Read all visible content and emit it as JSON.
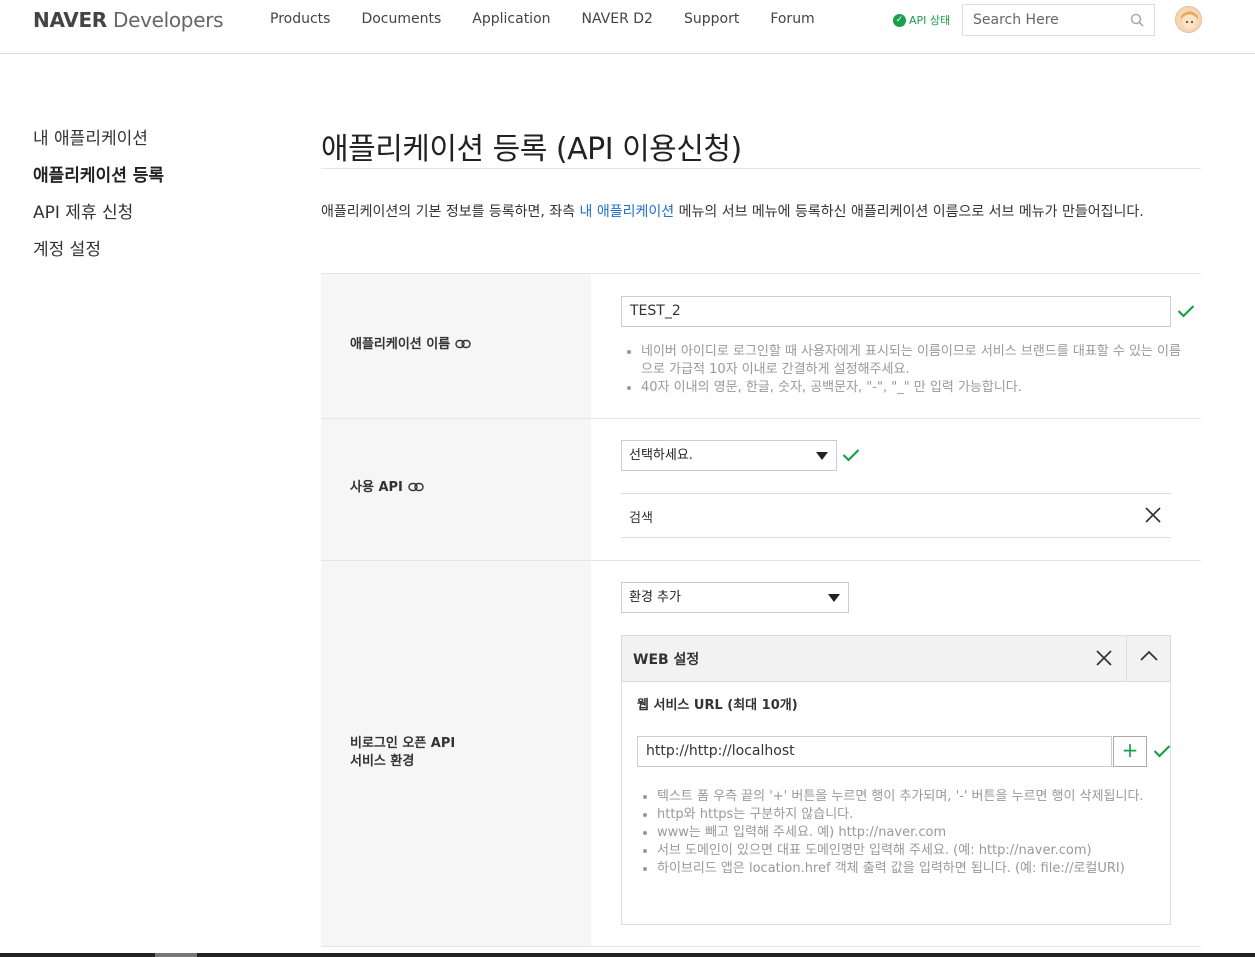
{
  "header": {
    "logo_brand": "NAVER",
    "logo_sub": "Developers",
    "nav": [
      "Products",
      "Documents",
      "Application",
      "NAVER D2",
      "Support",
      "Forum"
    ],
    "api_status": "API 상태",
    "search_placeholder": "Search Here"
  },
  "sidebar": {
    "items": [
      {
        "label": "내 애플리케이션",
        "active": false
      },
      {
        "label": "애플리케이션 등록",
        "active": true
      },
      {
        "label": "API 제휴 신청",
        "active": false
      },
      {
        "label": "계정 설정",
        "active": false
      }
    ]
  },
  "main": {
    "title": "애플리케이션 등록 (API 이용신청)",
    "desc_before": "애플리케이션의 기본 정보를 등록하면, 좌측 ",
    "desc_link": "내 애플리케이션",
    "desc_after": " 메뉴의 서브 메뉴에 등록하신 애플리케이션 이름으로 서브 메뉴가 만들어집니다."
  },
  "form": {
    "app_name": {
      "label": "애플리케이션 이름",
      "value": "TEST_2",
      "help": [
        "네이버 아이디로 로그인할 때 사용자에게 표시되는 이름이므로 서비스 브랜드를 대표할 수 있는 이름으로 가급적 10자 이내로 간결하게 설정해주세요.",
        "40자 이내의 영문, 한글, 숫자, 공백문자, \"-\", \"_\" 만 입력 가능합니다."
      ]
    },
    "api": {
      "label": "사용 API",
      "select": "선택하세요.",
      "selected_item": "검색"
    },
    "env": {
      "label_line1": "비로그인 오픈 API",
      "label_line2": "서비스 환경",
      "select": "환경 추가",
      "panel_title": "WEB 설정",
      "url_title": "웹 서비스 URL (최대 10개)",
      "url_value": "http://http://localhost",
      "help": [
        "텍스트 폼 우측 끝의 '+' 버튼을 누르면 행이 추가되며, '-' 버튼을 누르면 행이 삭제됩니다.",
        "http와 https는 구분하지 않습니다.",
        "www는 빼고 입력해 주세요. 예) http://naver.com",
        "서브 도메인이 있으면 대표 도메인명만 입력해 주세요. (예: http://naver.com)",
        "하이브리드 앱은 location.href 객체 출력 값을 입력하면 됩니다. (예: file://로컬URI)"
      ]
    }
  },
  "colors": {
    "accent_green": "#19a04b",
    "link_blue": "#1f6fd0"
  }
}
